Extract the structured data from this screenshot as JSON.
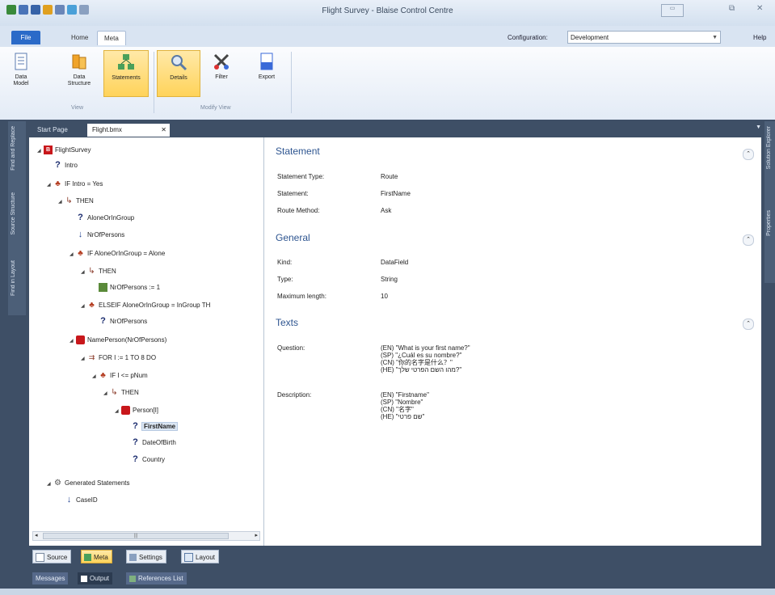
{
  "window": {
    "title": "Flight Survey - Blaise Control Centre",
    "min_btn": "▭",
    "restore_btn": "⧉",
    "close_btn": "✕"
  },
  "ribbon_tabs": {
    "file": "File",
    "home": "Home",
    "meta": "Meta"
  },
  "configuration": {
    "label": "Configuration:",
    "value": "Development",
    "help": "Help"
  },
  "ribbon": {
    "view_buttons": [
      {
        "line1": "Data",
        "line2": "Model"
      },
      {
        "line1": "Data",
        "line2": "Structure"
      },
      {
        "line1": "Statements",
        "line2": ""
      }
    ],
    "modify_buttons": [
      {
        "label": "Details"
      },
      {
        "label": "Filter"
      },
      {
        "label": "Export"
      }
    ],
    "group_view": "View",
    "group_modify": "Modify View"
  },
  "side_tabs": {
    "left": [
      "Find and Replace",
      "Source Structure",
      "Find in Layout"
    ],
    "right": [
      "Solution Explorer",
      "Properties"
    ]
  },
  "doc_tabs": {
    "start": "Start Page",
    "flight": "Flight.bmx",
    "close": "✕"
  },
  "tree": {
    "nodes": [
      {
        "label": "FlightSurvey",
        "icon": "survey-icon",
        "expand": "◢",
        "selected": false
      },
      {
        "label": "Intro",
        "icon": "question-icon",
        "expand": "",
        "selected": false
      },
      {
        "label": "IF Intro = Yes",
        "icon": "if-condition-icon",
        "expand": "◢",
        "selected": false
      },
      {
        "label": "THEN",
        "icon": "then-branch-icon",
        "expand": "◢",
        "selected": false
      },
      {
        "label": "AloneOrInGroup",
        "icon": "question-icon",
        "expand": "",
        "selected": false
      },
      {
        "label": "NrOfPersons",
        "icon": "ask-arrow-icon",
        "expand": "",
        "selected": false
      },
      {
        "label": "IF AloneOrInGroup = Alone",
        "icon": "if-condition-icon",
        "expand": "◢",
        "selected": false
      },
      {
        "label": "THEN",
        "icon": "then-branch-icon",
        "expand": "◢",
        "selected": false
      },
      {
        "label": "NrOfPersons := 1",
        "icon": "assignment-icon",
        "expand": "",
        "selected": false
      },
      {
        "label": "ELSEIF AloneOrInGroup = InGroup TH",
        "icon": "elseif-condition-icon",
        "expand": "◢",
        "selected": false
      },
      {
        "label": "NrOfPersons",
        "icon": "question-icon",
        "expand": "",
        "selected": false
      },
      {
        "label": "NamePerson(NrOfPersons)",
        "icon": "block-icon",
        "expand": "◢",
        "selected": false
      },
      {
        "label": "FOR I := 1 TO 8 DO",
        "icon": "for-loop-icon",
        "expand": "◢",
        "selected": false
      },
      {
        "label": "IF I <= pNum",
        "icon": "if-condition-icon",
        "expand": "◢",
        "selected": false
      },
      {
        "label": "THEN",
        "icon": "then-branch-icon",
        "expand": "◢",
        "selected": false
      },
      {
        "label": "Person[I]",
        "icon": "block-icon",
        "expand": "◢",
        "selected": false
      },
      {
        "label": "FirstName",
        "icon": "question-icon",
        "expand": "",
        "selected": true
      },
      {
        "label": "DateOfBirth",
        "icon": "question-icon",
        "expand": "",
        "selected": false
      },
      {
        "label": "Country",
        "icon": "question-icon",
        "expand": "",
        "selected": false
      },
      {
        "label": "Generated Statements",
        "icon": "generated-icon",
        "expand": "◢",
        "selected": false
      },
      {
        "label": "CaseID",
        "icon": "ask-arrow-icon",
        "expand": "",
        "selected": false
      }
    ],
    "scroll_left": "◂",
    "scroll_right": "▸",
    "scroll_grip": "|||"
  },
  "details": {
    "statement": {
      "title": "Statement",
      "rows": [
        {
          "label": "Statement Type:",
          "value": "Route"
        },
        {
          "label": "Statement:",
          "value": "FirstName"
        },
        {
          "label": "Route Method:",
          "value": "Ask"
        }
      ]
    },
    "general": {
      "title": "General",
      "rows": [
        {
          "label": "Kind:",
          "value": "DataField"
        },
        {
          "label": "Type:",
          "value": "String"
        },
        {
          "label": "Maximum length:",
          "value": "10"
        }
      ]
    },
    "texts": {
      "title": "Texts",
      "question_label": "Question:",
      "question_lines": [
        "(EN) \"What is your first name?\"",
        "(SP) \"¿Cuál es su nombre?\"",
        "(CN) \"你的名字是什么？\"",
        "(HE) \"מהו השם הפרטי שלך?\""
      ],
      "description_label": "Description:",
      "description_lines": [
        "(EN) \"Firstname\"",
        "(SP) \"Nombre\"",
        "(CN) \"名字\"",
        "(HE) \"שם פרטי\""
      ]
    },
    "collapse_glyph": "⌃"
  },
  "bottom_tabs": {
    "source": "Source",
    "meta": "Meta",
    "settings": "Settings",
    "layout": "Layout"
  },
  "output_tabs": {
    "messages": "Messages",
    "output": "Output",
    "references": "References List"
  },
  "colors": {
    "accent": "#2a6ac8",
    "active_tab": "#ffd35a",
    "section_title": "#2e5590",
    "workspace": "#3e4f66"
  }
}
